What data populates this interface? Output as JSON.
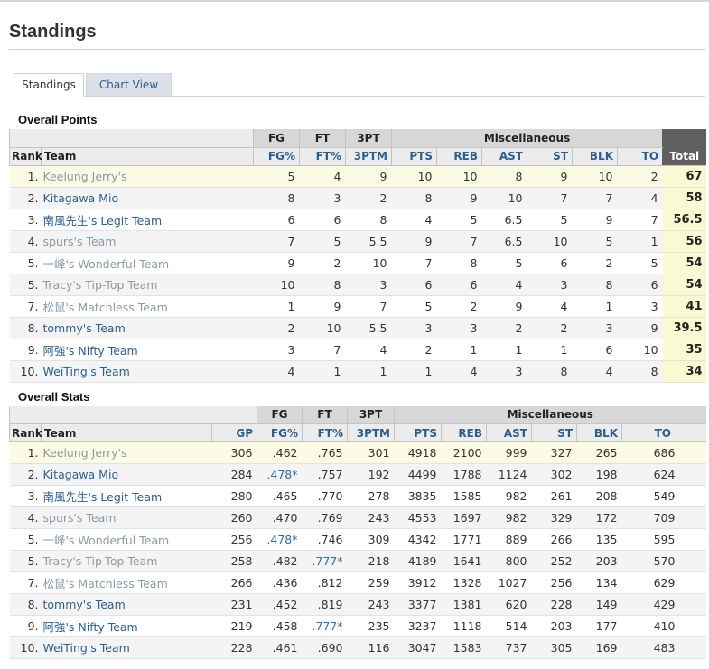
{
  "page": {
    "title": "Standings"
  },
  "tabs": [
    {
      "label": "Standings",
      "active": true
    },
    {
      "label": "Chart View",
      "active": false
    }
  ],
  "colors": {
    "link": "#2d5f8e",
    "total_bg": "#5f5f5f",
    "highlight": "#fafad2"
  },
  "points": {
    "section_title": "Overall Points",
    "groups": {
      "fg": "FG",
      "ft": "FT",
      "tpt": "3PT",
      "misc": "Miscellaneous"
    },
    "headers": {
      "rank": "Rank",
      "team": "Team",
      "fgp": "FG%",
      "ftp": "FT%",
      "tptm": "3PTM",
      "pts": "PTS",
      "reb": "REB",
      "ast": "AST",
      "st": "ST",
      "blk": "BLK",
      "to": "TO",
      "total": "Total"
    },
    "rows": [
      {
        "rank": "1.",
        "team": "Keelung Jerry's",
        "style": "gray",
        "fgp": "5",
        "ftp": "4",
        "tptm": "9",
        "pts": "10",
        "reb": "10",
        "ast": "8",
        "st": "9",
        "blk": "10",
        "to": "2",
        "total": "67"
      },
      {
        "rank": "2.",
        "team": "Kitagawa Mio",
        "style": "blue",
        "fgp": "8",
        "ftp": "3",
        "tptm": "2",
        "pts": "8",
        "reb": "9",
        "ast": "10",
        "st": "7",
        "blk": "7",
        "to": "4",
        "total": "58"
      },
      {
        "rank": "3.",
        "team": "南風先生's Legit Team",
        "style": "blue",
        "fgp": "6",
        "ftp": "6",
        "tptm": "8",
        "pts": "4",
        "reb": "5",
        "ast": "6.5",
        "st": "5",
        "blk": "9",
        "to": "7",
        "total": "56.5"
      },
      {
        "rank": "4.",
        "team": "spurs's Team",
        "style": "gray",
        "fgp": "7",
        "ftp": "5",
        "tptm": "5.5",
        "pts": "9",
        "reb": "7",
        "ast": "6.5",
        "st": "10",
        "blk": "5",
        "to": "1",
        "total": "56"
      },
      {
        "rank": "5.",
        "team": "一峰's Wonderful Team",
        "style": "gray",
        "fgp": "9",
        "ftp": "2",
        "tptm": "10",
        "pts": "7",
        "reb": "8",
        "ast": "5",
        "st": "6",
        "blk": "2",
        "to": "5",
        "total": "54"
      },
      {
        "rank": "5.",
        "team": "Tracy's Tip-Top Team",
        "style": "gray",
        "fgp": "10",
        "ftp": "8",
        "tptm": "3",
        "pts": "6",
        "reb": "6",
        "ast": "4",
        "st": "3",
        "blk": "8",
        "to": "6",
        "total": "54"
      },
      {
        "rank": "7.",
        "team": "松鼠's Matchless Team",
        "style": "gray",
        "fgp": "1",
        "ftp": "9",
        "tptm": "7",
        "pts": "5",
        "reb": "2",
        "ast": "9",
        "st": "4",
        "blk": "1",
        "to": "3",
        "total": "41"
      },
      {
        "rank": "8.",
        "team": "tommy's Team",
        "style": "blue",
        "fgp": "2",
        "ftp": "10",
        "tptm": "5.5",
        "pts": "3",
        "reb": "3",
        "ast": "2",
        "st": "2",
        "blk": "3",
        "to": "9",
        "total": "39.5"
      },
      {
        "rank": "9.",
        "team": "阿強's Nifty Team",
        "style": "blue",
        "fgp": "3",
        "ftp": "7",
        "tptm": "4",
        "pts": "2",
        "reb": "1",
        "ast": "1",
        "st": "1",
        "blk": "6",
        "to": "10",
        "total": "35"
      },
      {
        "rank": "10.",
        "team": "WeiTing's Team",
        "style": "blue",
        "fgp": "4",
        "ftp": "1",
        "tptm": "1",
        "pts": "1",
        "reb": "4",
        "ast": "3",
        "st": "8",
        "blk": "4",
        "to": "8",
        "total": "34"
      }
    ]
  },
  "stats": {
    "section_title": "Overall Stats",
    "groups": {
      "fg": "FG",
      "ft": "FT",
      "tpt": "3PT",
      "misc": "Miscellaneous"
    },
    "headers": {
      "rank": "Rank",
      "team": "Team",
      "gp": "GP",
      "fgp": "FG%",
      "ftp": "FT%",
      "tptm": "3PTM",
      "pts": "PTS",
      "reb": "REB",
      "ast": "AST",
      "st": "ST",
      "blk": "BLK",
      "to": "TO"
    },
    "rows": [
      {
        "rank": "1.",
        "team": "Keelung Jerry's",
        "style": "gray",
        "gp": "306",
        "fgp": ".462",
        "ftp": ".765",
        "tptm": "301",
        "pts": "4918",
        "reb": "2100",
        "ast": "999",
        "st": "327",
        "blk": "265",
        "to": "686"
      },
      {
        "rank": "2.",
        "team": "Kitagawa Mio",
        "style": "blue",
        "gp": "284",
        "fgp": ".478*",
        "fgp_hi": true,
        "ftp": ".757",
        "tptm": "192",
        "pts": "4499",
        "reb": "1788",
        "ast": "1124",
        "st": "302",
        "blk": "198",
        "to": "624"
      },
      {
        "rank": "3.",
        "team": "南風先生's Legit Team",
        "style": "blue",
        "gp": "280",
        "fgp": ".465",
        "ftp": ".770",
        "tptm": "278",
        "pts": "3835",
        "reb": "1585",
        "ast": "982",
        "st": "261",
        "blk": "208",
        "to": "549"
      },
      {
        "rank": "4.",
        "team": "spurs's Team",
        "style": "gray",
        "gp": "260",
        "fgp": ".470",
        "ftp": ".769",
        "tptm": "243",
        "pts": "4553",
        "reb": "1697",
        "ast": "982",
        "st": "329",
        "blk": "172",
        "to": "709"
      },
      {
        "rank": "5.",
        "team": "一峰's Wonderful Team",
        "style": "gray",
        "gp": "256",
        "fgp": ".478*",
        "fgp_hi": true,
        "ftp": ".746",
        "tptm": "309",
        "pts": "4342",
        "reb": "1771",
        "ast": "889",
        "st": "266",
        "blk": "135",
        "to": "595"
      },
      {
        "rank": "5.",
        "team": "Tracy's Tip-Top Team",
        "style": "gray",
        "gp": "258",
        "fgp": ".482",
        "ftp": ".777*",
        "ftp_hi": true,
        "tptm": "218",
        "pts": "4189",
        "reb": "1641",
        "ast": "800",
        "st": "252",
        "blk": "203",
        "to": "570"
      },
      {
        "rank": "7.",
        "team": "松鼠's Matchless Team",
        "style": "gray",
        "gp": "266",
        "fgp": ".436",
        "ftp": ".812",
        "tptm": "259",
        "pts": "3912",
        "reb": "1328",
        "ast": "1027",
        "st": "256",
        "blk": "134",
        "to": "629"
      },
      {
        "rank": "8.",
        "team": "tommy's Team",
        "style": "blue",
        "gp": "231",
        "fgp": ".452",
        "ftp": ".819",
        "tptm": "243",
        "pts": "3377",
        "reb": "1381",
        "ast": "620",
        "st": "228",
        "blk": "149",
        "to": "429"
      },
      {
        "rank": "9.",
        "team": "阿強's Nifty Team",
        "style": "blue",
        "gp": "219",
        "fgp": ".458",
        "ftp": ".777*",
        "ftp_hi": true,
        "tptm": "235",
        "pts": "3237",
        "reb": "1118",
        "ast": "514",
        "st": "203",
        "blk": "177",
        "to": "410"
      },
      {
        "rank": "10.",
        "team": "WeiTing's Team",
        "style": "blue",
        "gp": "228",
        "fgp": ".461",
        "ftp": ".690",
        "tptm": "116",
        "pts": "3047",
        "reb": "1583",
        "ast": "737",
        "st": "305",
        "blk": "169",
        "to": "483"
      }
    ]
  }
}
